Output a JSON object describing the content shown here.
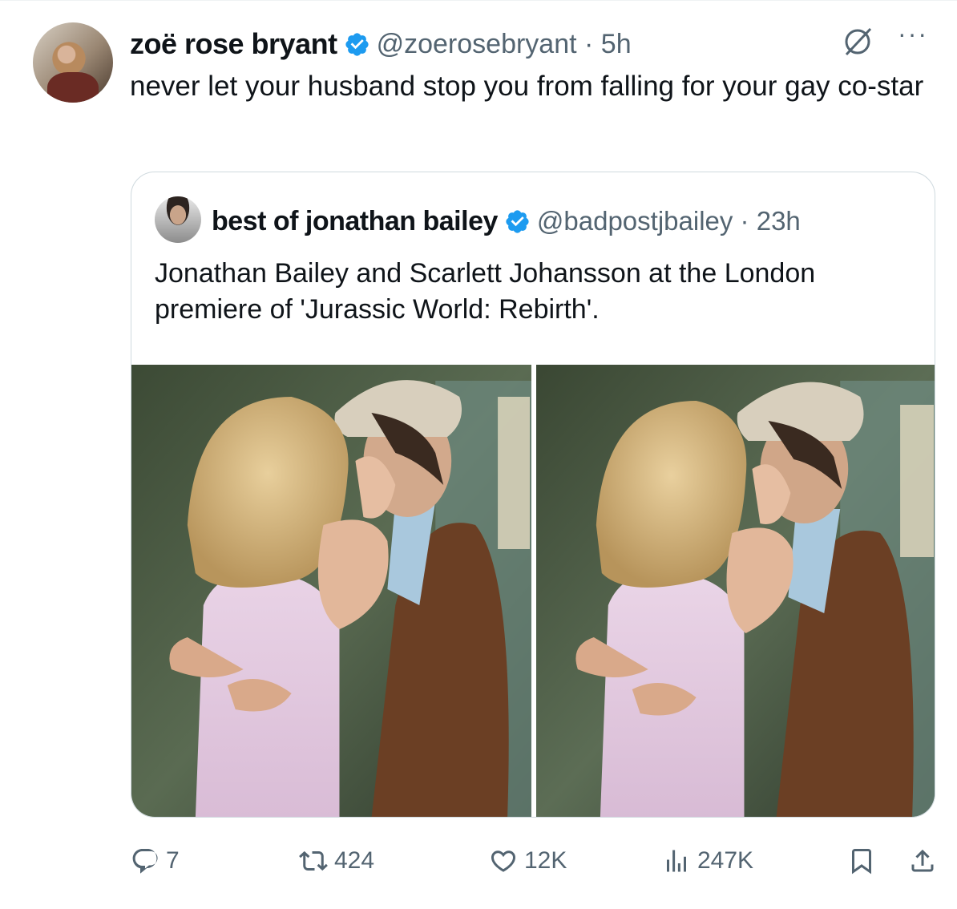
{
  "tweet": {
    "author_name": "zoë rose bryant",
    "author_handle": "@zoerosebryant",
    "time": "5h",
    "text": "never let your husband stop you from falling for your gay co-star",
    "more_label": "···"
  },
  "quoted": {
    "author_name": "best of jonathan bailey",
    "author_handle": "@badpostjbailey",
    "time": "23h",
    "text": "Jonathan Bailey and Scarlett Johansson at the London premiere of 'Jurassic World: Rebirth'."
  },
  "actions": {
    "replies": "7",
    "reposts": "424",
    "likes": "12K",
    "views": "247K"
  },
  "colors": {
    "verified": "#1d9bf0",
    "muted": "#536471",
    "border": "#cfd9de"
  },
  "icons": [
    "verified-badge-icon",
    "grok-icon",
    "more-icon",
    "reply-icon",
    "repost-icon",
    "like-icon",
    "views-icon",
    "bookmark-icon",
    "share-icon"
  ]
}
